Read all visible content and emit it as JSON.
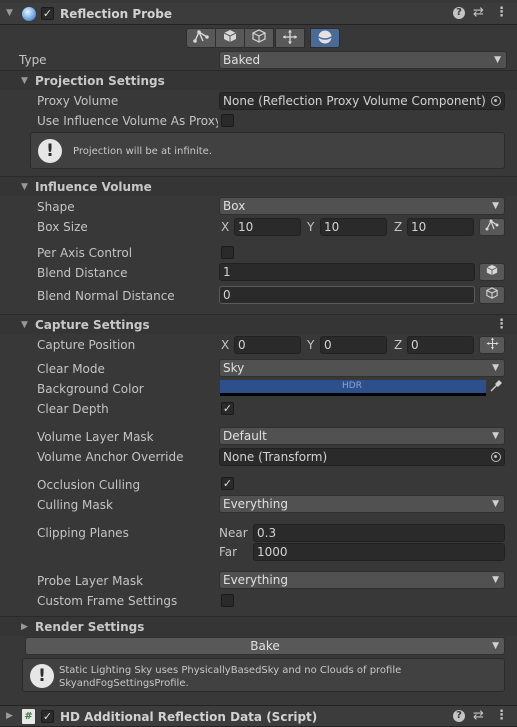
{
  "component": {
    "title": "Reflection Probe",
    "enabled": true
  },
  "type_field": {
    "label": "Type",
    "value": "Baked"
  },
  "projection": {
    "title": "Projection Settings",
    "proxy_volume_label": "Proxy Volume",
    "proxy_volume_value": "None (Reflection Proxy Volume Component)",
    "use_influence_label": "Use Influence Volume As Proxy V",
    "help_text": "Projection will be at infinite."
  },
  "influence": {
    "title": "Influence Volume",
    "shape_label": "Shape",
    "shape_value": "Box",
    "box_size_label": "Box Size",
    "box_x_axis": "X",
    "box_x": "10",
    "box_y_axis": "Y",
    "box_y": "10",
    "box_z_axis": "Z",
    "box_z": "10",
    "per_axis_label": "Per Axis Control",
    "blend_distance_label": "Blend Distance",
    "blend_distance_value": "1",
    "blend_normal_label": "Blend Normal Distance",
    "blend_normal_value": "0"
  },
  "capture": {
    "title": "Capture Settings",
    "position_label": "Capture Position",
    "pos_x_axis": "X",
    "pos_x": "0",
    "pos_y_axis": "Y",
    "pos_y": "0",
    "pos_z_axis": "Z",
    "pos_z": "0",
    "clear_mode_label": "Clear Mode",
    "clear_mode_value": "Sky",
    "bg_color_label": "Background Color",
    "bg_color_badge": "HDR",
    "bg_color_hex": "#2d4f8c",
    "clear_depth_label": "Clear Depth",
    "volume_layer_label": "Volume Layer Mask",
    "volume_layer_value": "Default",
    "volume_anchor_label": "Volume Anchor Override",
    "volume_anchor_value": "None (Transform)",
    "occlusion_label": "Occlusion Culling",
    "culling_mask_label": "Culling Mask",
    "culling_mask_value": "Everything",
    "clipping_label": "Clipping Planes",
    "near_label": "Near",
    "near_value": "0.3",
    "far_label": "Far",
    "far_value": "1000",
    "probe_layer_label": "Probe Layer Mask",
    "probe_layer_value": "Everything",
    "custom_frame_label": "Custom Frame Settings"
  },
  "render": {
    "title": "Render Settings",
    "bake_label": "Bake",
    "help_text_line1": "Static Lighting Sky uses PhysicallyBasedSky and no Clouds of profile",
    "help_text_line2": "SkyandFogSettingsProfile."
  },
  "second_component": {
    "title": "HD Additional Reflection Data (Script)",
    "enabled": true
  }
}
